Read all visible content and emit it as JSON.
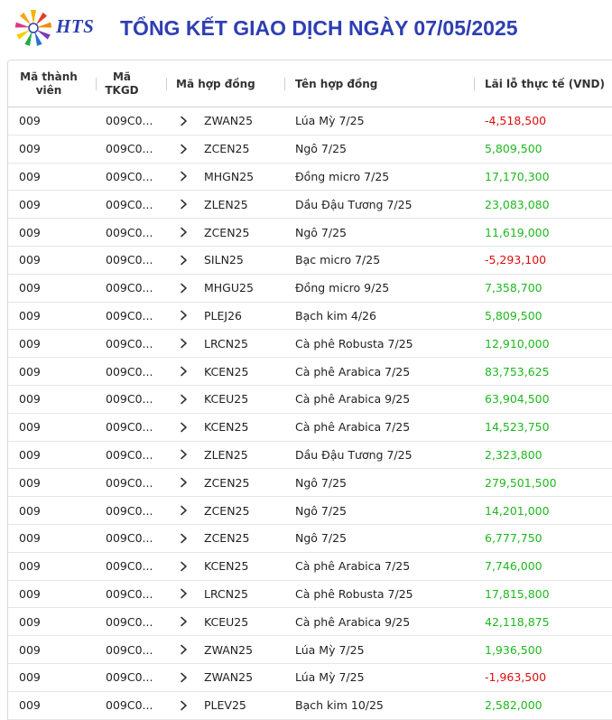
{
  "header": {
    "logo_text": "HTS",
    "title": "TỔNG KẾT GIAO DỊCH NGÀY 07/05/2025"
  },
  "table": {
    "columns": {
      "member": "Mã thành viên",
      "tkgd": "Mã TKGD",
      "contract_code": "Mã hợp đồng",
      "contract_name": "Tên hợp đồng",
      "pnl": "Lãi lỗ thực tế (VND)"
    },
    "rows": [
      {
        "member": "009",
        "tkgd": "009C0...",
        "code": "ZWAN25",
        "name": "Lúa Mỳ 7/25",
        "pnl": "-4,518,500",
        "sign": "neg"
      },
      {
        "member": "009",
        "tkgd": "009C0...",
        "code": "ZCEN25",
        "name": "Ngô 7/25",
        "pnl": "5,809,500",
        "sign": "pos"
      },
      {
        "member": "009",
        "tkgd": "009C0...",
        "code": "MHGN25",
        "name": "Đồng micro 7/25",
        "pnl": "17,170,300",
        "sign": "pos"
      },
      {
        "member": "009",
        "tkgd": "009C0...",
        "code": "ZLEN25",
        "name": "Dầu Đậu Tương 7/25",
        "pnl": "23,083,080",
        "sign": "pos"
      },
      {
        "member": "009",
        "tkgd": "009C0...",
        "code": "ZCEN25",
        "name": "Ngô 7/25",
        "pnl": "11,619,000",
        "sign": "pos"
      },
      {
        "member": "009",
        "tkgd": "009C0...",
        "code": "SILN25",
        "name": "Bạc micro 7/25",
        "pnl": "-5,293,100",
        "sign": "neg"
      },
      {
        "member": "009",
        "tkgd": "009C0...",
        "code": "MHGU25",
        "name": "Đồng micro 9/25",
        "pnl": "7,358,700",
        "sign": "pos"
      },
      {
        "member": "009",
        "tkgd": "009C0...",
        "code": "PLEJ26",
        "name": "Bạch kim 4/26",
        "pnl": "5,809,500",
        "sign": "pos"
      },
      {
        "member": "009",
        "tkgd": "009C0...",
        "code": "LRCN25",
        "name": "Cà phê Robusta 7/25",
        "pnl": "12,910,000",
        "sign": "pos"
      },
      {
        "member": "009",
        "tkgd": "009C0...",
        "code": "KCEN25",
        "name": "Cà phê Arabica 7/25",
        "pnl": "83,753,625",
        "sign": "pos"
      },
      {
        "member": "009",
        "tkgd": "009C0...",
        "code": "KCEU25",
        "name": "Cà phê Arabica 9/25",
        "pnl": "63,904,500",
        "sign": "pos"
      },
      {
        "member": "009",
        "tkgd": "009C0...",
        "code": "KCEN25",
        "name": "Cà phê Arabica 7/25",
        "pnl": "14,523,750",
        "sign": "pos"
      },
      {
        "member": "009",
        "tkgd": "009C0...",
        "code": "ZLEN25",
        "name": "Dầu Đậu Tương 7/25",
        "pnl": "2,323,800",
        "sign": "pos"
      },
      {
        "member": "009",
        "tkgd": "009C0...",
        "code": "ZCEN25",
        "name": "Ngô 7/25",
        "pnl": "279,501,500",
        "sign": "pos"
      },
      {
        "member": "009",
        "tkgd": "009C0...",
        "code": "ZCEN25",
        "name": "Ngô 7/25",
        "pnl": "14,201,000",
        "sign": "pos"
      },
      {
        "member": "009",
        "tkgd": "009C0...",
        "code": "ZCEN25",
        "name": "Ngô 7/25",
        "pnl": "6,777,750",
        "sign": "pos"
      },
      {
        "member": "009",
        "tkgd": "009C0...",
        "code": "KCEN25",
        "name": "Cà phê Arabica 7/25",
        "pnl": "7,746,000",
        "sign": "pos"
      },
      {
        "member": "009",
        "tkgd": "009C0...",
        "code": "LRCN25",
        "name": "Cà phê Robusta 7/25",
        "pnl": "17,815,800",
        "sign": "pos"
      },
      {
        "member": "009",
        "tkgd": "009C0...",
        "code": "KCEU25",
        "name": "Cà phê Arabica 9/25",
        "pnl": "42,118,875",
        "sign": "pos"
      },
      {
        "member": "009",
        "tkgd": "009C0...",
        "code": "ZWAN25",
        "name": "Lúa Mỳ 7/25",
        "pnl": "1,936,500",
        "sign": "pos"
      },
      {
        "member": "009",
        "tkgd": "009C0...",
        "code": "ZWAN25",
        "name": "Lúa Mỳ 7/25",
        "pnl": "-1,963,500",
        "sign": "neg"
      },
      {
        "member": "009",
        "tkgd": "009C0...",
        "code": "PLEV25",
        "name": "Bạch kim 10/25",
        "pnl": "2,582,000",
        "sign": "pos"
      }
    ]
  },
  "colors": {
    "title": "#2e3fb2",
    "positive": "#1fb81f",
    "negative": "#e00d0d"
  }
}
